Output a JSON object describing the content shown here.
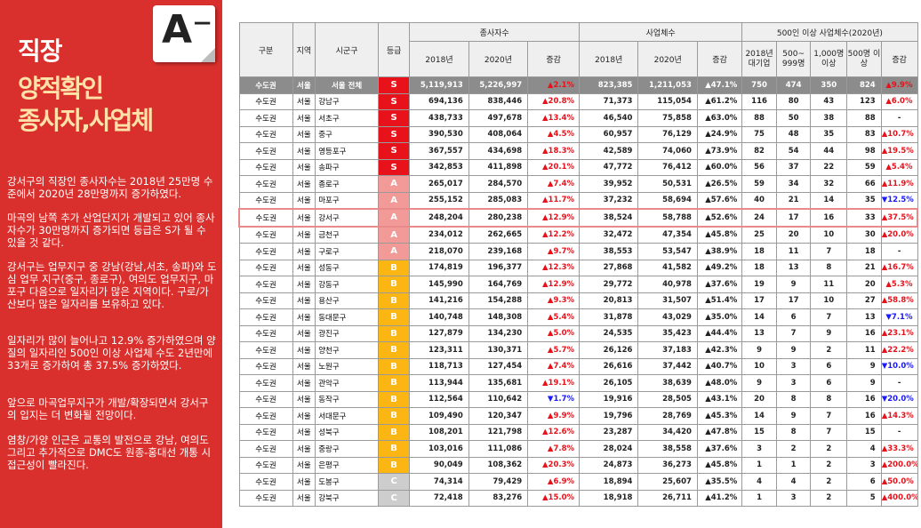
{
  "badge": "A⁻",
  "title": {
    "line1": "직장",
    "line2": "양적확인",
    "line3": "종사자,사업체"
  },
  "paragraphs": [
    "강서구의 직장인 종사자수는 2018년 25만명 수준에서 2020년 28만명까지 증가하였다.",
    "마곡의 남쪽 추가 산업단지가 개발되고 있어 종사자수가 30만명까지 증가되면 등급은 S가 될 수 있을 것 같다.",
    "강서구는 업무지구 중 강남(강남,서초, 송파)와 도심 업무 지구(중구, 종로구), 여의도 업무지구, 마포구 다음으로 일자리가 많은 지역이다. 구로/가산보다 많은 일자리를 보유하고 있다.",
    "일자리가 많이 늘어나고 12.9% 증가하였으며 양질의 일자리인 500인 이상 사업체 수도 2년만에 33개로 증가하여 총 37.5% 증가하였다.",
    "앞으로 마곡업무지구가 개발/확장되면서 강서구의 입지는 더 변화될 전망이다.",
    "염창/가양 인근은 교통의 발전으로 강남, 여의도 그리고 추가적으로 DMC도 원종-홍대선 개통 시 접근성이 빨라진다."
  ],
  "table": {
    "headers": {
      "gubun": "구분",
      "region": "지역",
      "gu": "시군구",
      "grade": "등급",
      "workers": "종사자수",
      "biz": "사업체수",
      "big": "500인 이상 사업체수(2020년)",
      "y2018": "2018년",
      "y2020": "2020년",
      "chg": "증감",
      "big_cols": [
        "2018년 대기업",
        "500~ 999명",
        "1,000명 이상",
        "500명 이상",
        "증감"
      ]
    },
    "rows": [
      {
        "c": "수도권",
        "r": "서울",
        "gu": "서울 전체",
        "g": "S",
        "w18": "5,119,913",
        "w20": "5,226,997",
        "wc": "▲2.1%",
        "wd": "up",
        "b18": "823,385",
        "b20": "1,211,053",
        "bc": "▲47.1%",
        "l18": "750",
        "l5": "474",
        "l1": "350",
        "l500": "824",
        "lc": "▲9.9%",
        "ld": "up",
        "total": true
      },
      {
        "c": "수도권",
        "r": "서울",
        "gu": "강남구",
        "g": "S",
        "w18": "694,136",
        "w20": "838,446",
        "wc": "▲20.8%",
        "wd": "up",
        "b18": "71,373",
        "b20": "115,054",
        "bc": "▲61.2%",
        "l18": "116",
        "l5": "80",
        "l1": "43",
        "l500": "123",
        "lc": "▲6.0%",
        "ld": "up"
      },
      {
        "c": "수도권",
        "r": "서울",
        "gu": "서초구",
        "g": "S",
        "w18": "438,733",
        "w20": "497,678",
        "wc": "▲13.4%",
        "wd": "up",
        "b18": "46,540",
        "b20": "75,858",
        "bc": "▲63.0%",
        "l18": "88",
        "l5": "50",
        "l1": "38",
        "l500": "88",
        "lc": "-",
        "ld": "flat"
      },
      {
        "c": "수도권",
        "r": "서울",
        "gu": "중구",
        "g": "S",
        "w18": "390,530",
        "w20": "408,064",
        "wc": "▲4.5%",
        "wd": "up",
        "b18": "60,957",
        "b20": "76,129",
        "bc": "▲24.9%",
        "l18": "75",
        "l5": "48",
        "l1": "35",
        "l500": "83",
        "lc": "▲10.7%",
        "ld": "up"
      },
      {
        "c": "수도권",
        "r": "서울",
        "gu": "영등포구",
        "g": "S",
        "w18": "367,557",
        "w20": "434,698",
        "wc": "▲18.3%",
        "wd": "up",
        "b18": "42,589",
        "b20": "74,060",
        "bc": "▲73.9%",
        "l18": "82",
        "l5": "54",
        "l1": "44",
        "l500": "98",
        "lc": "▲19.5%",
        "ld": "up"
      },
      {
        "c": "수도권",
        "r": "서울",
        "gu": "송파구",
        "g": "S",
        "w18": "342,853",
        "w20": "411,898",
        "wc": "▲20.1%",
        "wd": "up",
        "b18": "47,772",
        "b20": "76,412",
        "bc": "▲60.0%",
        "l18": "56",
        "l5": "37",
        "l1": "22",
        "l500": "59",
        "lc": "▲5.4%",
        "ld": "up"
      },
      {
        "c": "수도권",
        "r": "서울",
        "gu": "종로구",
        "g": "A",
        "w18": "265,017",
        "w20": "284,570",
        "wc": "▲7.4%",
        "wd": "up",
        "b18": "39,952",
        "b20": "50,531",
        "bc": "▲26.5%",
        "l18": "59",
        "l5": "34",
        "l1": "32",
        "l500": "66",
        "lc": "▲11.9%",
        "ld": "up"
      },
      {
        "c": "수도권",
        "r": "서울",
        "gu": "마포구",
        "g": "A",
        "w18": "255,152",
        "w20": "285,083",
        "wc": "▲11.7%",
        "wd": "up",
        "b18": "37,232",
        "b20": "58,694",
        "bc": "▲57.6%",
        "l18": "40",
        "l5": "21",
        "l1": "14",
        "l500": "35",
        "lc": "▼12.5%",
        "ld": "down"
      },
      {
        "c": "수도권",
        "r": "서울",
        "gu": "강서구",
        "g": "A",
        "w18": "248,204",
        "w20": "280,238",
        "wc": "▲12.9%",
        "wd": "up",
        "b18": "38,524",
        "b20": "58,788",
        "bc": "▲52.6%",
        "l18": "24",
        "l5": "17",
        "l1": "16",
        "l500": "33",
        "lc": "▲37.5%",
        "ld": "up",
        "hl": true
      },
      {
        "c": "수도권",
        "r": "서울",
        "gu": "금천구",
        "g": "A",
        "w18": "234,012",
        "w20": "262,665",
        "wc": "▲12.2%",
        "wd": "up",
        "b18": "32,472",
        "b20": "47,354",
        "bc": "▲45.8%",
        "l18": "25",
        "l5": "20",
        "l1": "10",
        "l500": "30",
        "lc": "▲20.0%",
        "ld": "up"
      },
      {
        "c": "수도권",
        "r": "서울",
        "gu": "구로구",
        "g": "A",
        "w18": "218,070",
        "w20": "239,168",
        "wc": "▲9.7%",
        "wd": "up",
        "b18": "38,553",
        "b20": "53,547",
        "bc": "▲38.9%",
        "l18": "18",
        "l5": "11",
        "l1": "7",
        "l500": "18",
        "lc": "-",
        "ld": "flat"
      },
      {
        "c": "수도권",
        "r": "서울",
        "gu": "성동구",
        "g": "B",
        "w18": "174,819",
        "w20": "196,377",
        "wc": "▲12.3%",
        "wd": "up",
        "b18": "27,868",
        "b20": "41,582",
        "bc": "▲49.2%",
        "l18": "18",
        "l5": "13",
        "l1": "8",
        "l500": "21",
        "lc": "▲16.7%",
        "ld": "up"
      },
      {
        "c": "수도권",
        "r": "서울",
        "gu": "강동구",
        "g": "B",
        "w18": "145,990",
        "w20": "164,769",
        "wc": "▲12.9%",
        "wd": "up",
        "b18": "29,772",
        "b20": "40,978",
        "bc": "▲37.6%",
        "l18": "19",
        "l5": "9",
        "l1": "11",
        "l500": "20",
        "lc": "▲5.3%",
        "ld": "up"
      },
      {
        "c": "수도권",
        "r": "서울",
        "gu": "용산구",
        "g": "B",
        "w18": "141,216",
        "w20": "154,288",
        "wc": "▲9.3%",
        "wd": "up",
        "b18": "20,813",
        "b20": "31,507",
        "bc": "▲51.4%",
        "l18": "17",
        "l5": "17",
        "l1": "10",
        "l500": "27",
        "lc": "▲58.8%",
        "ld": "up"
      },
      {
        "c": "수도권",
        "r": "서울",
        "gu": "동대문구",
        "g": "B",
        "w18": "140,748",
        "w20": "148,308",
        "wc": "▲5.4%",
        "wd": "up",
        "b18": "31,878",
        "b20": "43,029",
        "bc": "▲35.0%",
        "l18": "14",
        "l5": "6",
        "l1": "7",
        "l500": "13",
        "lc": "▼7.1%",
        "ld": "down"
      },
      {
        "c": "수도권",
        "r": "서울",
        "gu": "광진구",
        "g": "B",
        "w18": "127,879",
        "w20": "134,230",
        "wc": "▲5.0%",
        "wd": "up",
        "b18": "24,535",
        "b20": "35,423",
        "bc": "▲44.4%",
        "l18": "13",
        "l5": "7",
        "l1": "9",
        "l500": "16",
        "lc": "▲23.1%",
        "ld": "up"
      },
      {
        "c": "수도권",
        "r": "서울",
        "gu": "양천구",
        "g": "B",
        "w18": "123,311",
        "w20": "130,371",
        "wc": "▲5.7%",
        "wd": "up",
        "b18": "26,126",
        "b20": "37,183",
        "bc": "▲42.3%",
        "l18": "9",
        "l5": "9",
        "l1": "2",
        "l500": "11",
        "lc": "▲22.2%",
        "ld": "up"
      },
      {
        "c": "수도권",
        "r": "서울",
        "gu": "노원구",
        "g": "B",
        "w18": "118,713",
        "w20": "127,454",
        "wc": "▲7.4%",
        "wd": "up",
        "b18": "26,616",
        "b20": "37,442",
        "bc": "▲40.7%",
        "l18": "10",
        "l5": "3",
        "l1": "6",
        "l500": "9",
        "lc": "▼10.0%",
        "ld": "down"
      },
      {
        "c": "수도권",
        "r": "서울",
        "gu": "관악구",
        "g": "B",
        "w18": "113,944",
        "w20": "135,681",
        "wc": "▲19.1%",
        "wd": "up",
        "b18": "26,105",
        "b20": "38,639",
        "bc": "▲48.0%",
        "l18": "9",
        "l5": "3",
        "l1": "6",
        "l500": "9",
        "lc": "-",
        "ld": "flat"
      },
      {
        "c": "수도권",
        "r": "서울",
        "gu": "동작구",
        "g": "B",
        "w18": "112,564",
        "w20": "110,642",
        "wc": "▼1.7%",
        "wd": "down",
        "b18": "19,916",
        "b20": "28,505",
        "bc": "▲43.1%",
        "l18": "20",
        "l5": "8",
        "l1": "8",
        "l500": "16",
        "lc": "▼20.0%",
        "ld": "down"
      },
      {
        "c": "수도권",
        "r": "서울",
        "gu": "서대문구",
        "g": "B",
        "w18": "109,490",
        "w20": "120,347",
        "wc": "▲9.9%",
        "wd": "up",
        "b18": "19,796",
        "b20": "28,769",
        "bc": "▲45.3%",
        "l18": "14",
        "l5": "9",
        "l1": "7",
        "l500": "16",
        "lc": "▲14.3%",
        "ld": "up"
      },
      {
        "c": "수도권",
        "r": "서울",
        "gu": "성북구",
        "g": "B",
        "w18": "108,201",
        "w20": "121,798",
        "wc": "▲12.6%",
        "wd": "up",
        "b18": "23,287",
        "b20": "34,420",
        "bc": "▲47.8%",
        "l18": "15",
        "l5": "8",
        "l1": "7",
        "l500": "15",
        "lc": "-",
        "ld": "flat"
      },
      {
        "c": "수도권",
        "r": "서울",
        "gu": "중랑구",
        "g": "B",
        "w18": "103,016",
        "w20": "111,086",
        "wc": "▲7.8%",
        "wd": "up",
        "b18": "28,024",
        "b20": "38,558",
        "bc": "▲37.6%",
        "l18": "3",
        "l5": "2",
        "l1": "2",
        "l500": "4",
        "lc": "▲33.3%",
        "ld": "up"
      },
      {
        "c": "수도권",
        "r": "서울",
        "gu": "은평구",
        "g": "B",
        "w18": "90,049",
        "w20": "108,362",
        "wc": "▲20.3%",
        "wd": "up",
        "b18": "24,873",
        "b20": "36,273",
        "bc": "▲45.8%",
        "l18": "1",
        "l5": "1",
        "l1": "2",
        "l500": "3",
        "lc": "▲200.0%",
        "ld": "up"
      },
      {
        "c": "수도권",
        "r": "서울",
        "gu": "도봉구",
        "g": "C",
        "w18": "74,314",
        "w20": "79,429",
        "wc": "▲6.9%",
        "wd": "up",
        "b18": "18,894",
        "b20": "25,607",
        "bc": "▲35.5%",
        "l18": "4",
        "l5": "4",
        "l1": "2",
        "l500": "6",
        "lc": "▲50.0%",
        "ld": "up"
      },
      {
        "c": "수도권",
        "r": "서울",
        "gu": "강북구",
        "g": "C",
        "w18": "72,418",
        "w20": "83,276",
        "wc": "▲15.0%",
        "wd": "up",
        "b18": "18,918",
        "b20": "26,711",
        "bc": "▲41.2%",
        "l18": "1",
        "l5": "3",
        "l1": "2",
        "l500": "5",
        "lc": "▲400.0%",
        "ld": "up"
      }
    ]
  }
}
